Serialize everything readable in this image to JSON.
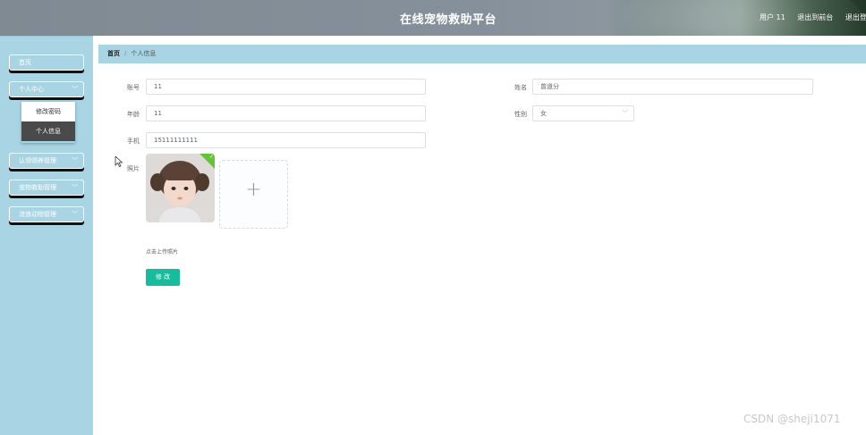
{
  "header": {
    "title": "在线宠物救助平台",
    "user": "用户 11",
    "back_front": "退出到前台",
    "logout": "退出登"
  },
  "sidebar": {
    "items": [
      {
        "label": "首页",
        "has_chevron": false
      },
      {
        "label": "个人中心",
        "has_chevron": true
      },
      {
        "label": "认领领养管理",
        "has_chevron": true
      },
      {
        "label": "宠物救助管理",
        "has_chevron": true
      },
      {
        "label": "流浪动物管理",
        "has_chevron": true
      }
    ],
    "submenu": [
      {
        "label": "修改密码"
      },
      {
        "label": "个人信息"
      }
    ]
  },
  "breadcrumb": {
    "home": "首页",
    "separator": "/",
    "current": "个人信息"
  },
  "form": {
    "account_label": "账号",
    "account_value": "11",
    "name_label": "姓名",
    "name_value": "曾道分",
    "age_label": "年龄",
    "age_value": "11",
    "gender_label": "性别",
    "gender_value": "女",
    "phone_label": "手机",
    "phone_value": "15111111111",
    "photo_label": "照片",
    "upload_hint": "点击上传照片",
    "submit_label": "修 改"
  },
  "watermark": "CSDN @sheji1071",
  "colors": {
    "sidebar_bg": "#a8d4e3",
    "submit_green": "#18bc9c",
    "menu_shadow": "#111111"
  }
}
